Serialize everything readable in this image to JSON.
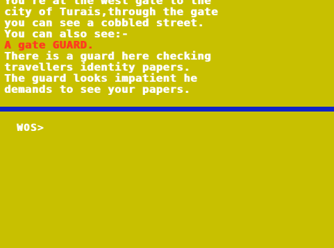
{
  "narrative": {
    "lines": [
      "You're at the west gate to the",
      "city of Turais,through the gate",
      "you can see a cobbled street.",
      "You can also see:-",
      "A gate GUARD.",
      "There is a guard here checking",
      "travellers identity papers.",
      "The guard looks impatient he",
      "demands to see your papers."
    ]
  },
  "prompt": {
    "label": "WOS>",
    "value": ""
  },
  "colors": {
    "background": "#c8c000",
    "text": "#ffffff",
    "highlight": "#ff3b20",
    "divider": "#1024c8"
  }
}
